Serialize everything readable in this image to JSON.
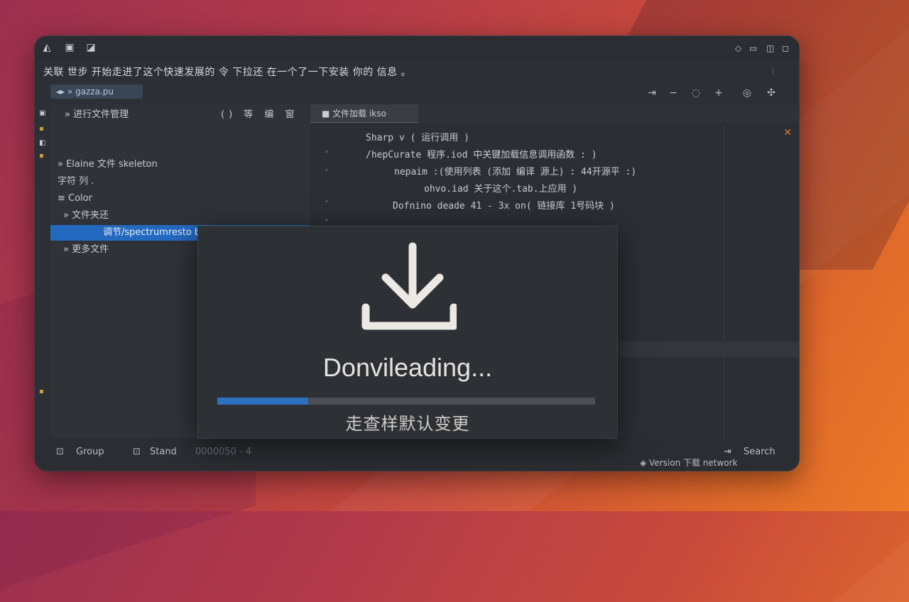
{
  "window": {
    "menu_text": "关联 世步 开始走进了这个快速发展的 令 下拉还 在一个了一下安装 你的 信息 。",
    "branch_label": "◂▸  » gazza.pu"
  },
  "explorer": {
    "header_title": "» 进行文件管理",
    "header_actions": "() 等 编 窗",
    "rows": [
      {
        "text": "» Elaine 文件 skeleton",
        "indent": 10,
        "selected": false
      },
      {
        "text": "字符 列 .",
        "indent": 10,
        "selected": false
      },
      {
        "text": "≡ Color",
        "indent": 10,
        "selected": false
      },
      {
        "text": "» 文件夹还",
        "indent": 18,
        "selected": false
      },
      {
        "text": "调节/spectrumresto ba",
        "indent": 74,
        "selected": true
      },
      {
        "text": "» 更多文件",
        "indent": 18,
        "selected": false
      }
    ]
  },
  "editor": {
    "tab_label": "■   文件加载 ikso",
    "code_lines": [
      "Sharp v  ( 运行调用 )",
      "/hepCurate 程序.iod 中关键加载信息调用函数 : )",
      "nepaim  :(使用列表 (添加 编译 源上) : 44开源平 :)",
      "ohvo.iad 关于这个.tab.上应用 )",
      "Dofnino  deade 41 - 3x on( 链接库 1号码块 )"
    ],
    "code_close": "✕"
  },
  "statusbar": {
    "left1": "Group",
    "left2": "Stand",
    "left3": "0000050 - 4",
    "right1": "Search",
    "right2": "◈ Version  下载 network"
  },
  "dialog": {
    "icon": "download-icon",
    "title": "Donvileading...",
    "subtitle": "走查样默认变更",
    "progress_fraction": 0.24
  },
  "colors": {
    "accent": "#2f6fbf",
    "selection": "#2469c0",
    "warning": "#e0782a"
  }
}
